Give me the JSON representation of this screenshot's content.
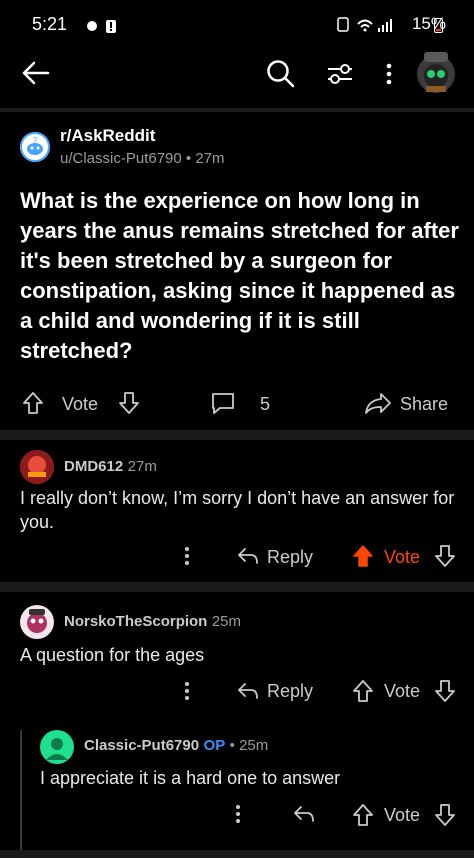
{
  "status": {
    "time": "5:21",
    "battery": "15%"
  },
  "post": {
    "subreddit": "r/AskReddit",
    "author": "u/Classic-Put6790",
    "age": "27m",
    "title": "What is the experience on how long in years the anus remains stretched for after it's been stretched by a surgeon for constipation, asking since it happened as a child and wondering if it is still stretched?",
    "vote_label": "Vote",
    "comment_count": "5",
    "share_label": "Share"
  },
  "comments": [
    {
      "user": "DMD612",
      "age": "27m",
      "body": "I really don’t know, I’m sorry I don’t have an answer for you.",
      "reply_label": "Reply",
      "vote_label": "Vote"
    },
    {
      "user": "NorskoTheScorpion",
      "age": "25m",
      "body": "A question for the ages",
      "reply_label": "Reply",
      "vote_label": "Vote"
    },
    {
      "user": "Classic-Put6790",
      "op": "OP",
      "age": "25m",
      "body": "I appreciate it is a hard one to answer",
      "vote_label": "Vote"
    }
  ],
  "colors": {
    "upvote_active": "#ff4500",
    "op_badge": "#3d8bfd",
    "accent_avatar": "#1fe08c"
  }
}
